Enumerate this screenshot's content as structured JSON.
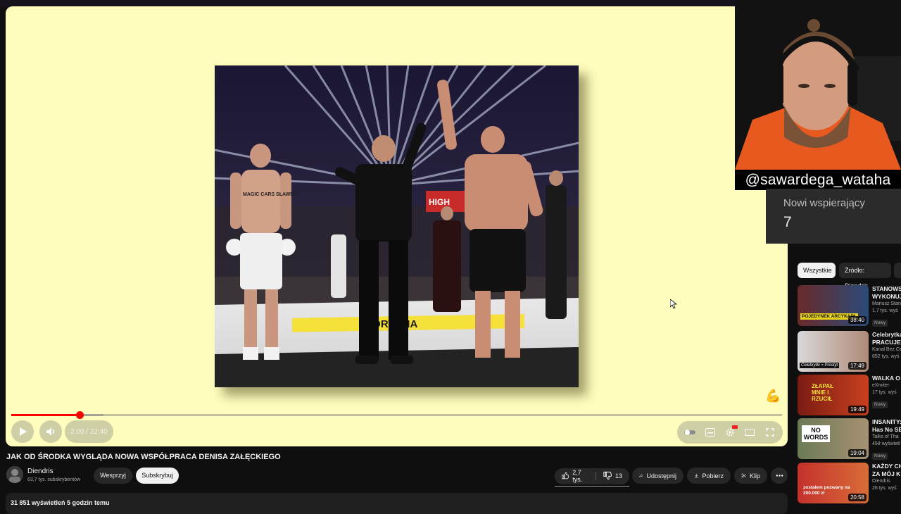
{
  "player": {
    "time": "2:00 / 22:40",
    "progress_fraction": 0.089,
    "loaded_fraction": 0.12
  },
  "overlay": {
    "handle": "@sawardega_wataha",
    "supporters_label": "Nowi wspierający",
    "supporters_count": "7"
  },
  "photo": {
    "banner_high": "HIGH",
    "banner_fortuna": "FORTUNA",
    "chest_text": "MAGIC CARS SŁAWNO"
  },
  "sidebar": {
    "chips": [
      "Wszystkie",
      "Źródło: Diendris"
    ],
    "videos": [
      {
        "title": "STANOWSK",
        "title2": "WYKONUJE",
        "channel": "Mariusz Stan",
        "views": "1,7 tys. wyś",
        "badge": "Nowy",
        "duration": "38:40",
        "thumb_text": "POJEDYNEK ARCYKAPŁ"
      },
      {
        "title": "Celebrytka",
        "title2": "PRACUJE A",
        "channel": "Kanał Bez Ce",
        "views": "652 tys. wyś",
        "badge": "",
        "duration": "17:49",
        "thumb_text": "Celebrytki = Prostyt"
      },
      {
        "title": "WALKA O F",
        "title2": "",
        "channel": "eXmiter",
        "views": "17 tys. wyś",
        "badge": "Nowy",
        "duration": "19:49",
        "thumb_text": "ZŁAPAŁ MNIE I RZUCIŁ"
      },
      {
        "title": "INSANITY:",
        "title2": "Has No SE",
        "channel": "Talks of Tha",
        "views": "458 wyświetl",
        "badge": "Nowy",
        "duration": "19:04",
        "thumb_text": "NO WORDS"
      },
      {
        "title": "KAŻDY CH",
        "title2": "ZA MÓJ K",
        "channel": "Diendris",
        "views": "26 tys. wyś",
        "badge": "",
        "duration": "20:58",
        "thumb_text": "zostałem pozwany na 200.000 zł"
      }
    ]
  },
  "video": {
    "title": "JAK OD ŚRODKA WYGLĄDA NOWA WSPÓŁPRACA DENISA ZAŁĘCKIEGO",
    "channel": "Diendris",
    "subscribers": "63,7 tys. subskrybentów",
    "support_label": "Wesprzyj",
    "subscribe_label": "Subskrybuj",
    "likes": "2,7 tys.",
    "dislikes": "13",
    "share_label": "Udostępnij",
    "download_label": "Pobierz",
    "clip_label": "Klip",
    "stats": "31 851 wyświetleń  5 godzin temu"
  },
  "colors": {
    "player_bg": "#fefdbd",
    "progress": "#ff0000",
    "page_bg": "#0f0f0f",
    "supporters_bg": "#2b2b2b"
  }
}
